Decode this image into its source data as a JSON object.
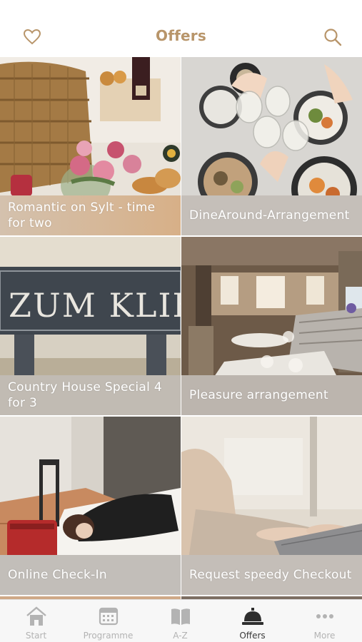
{
  "header": {
    "title": "Offers",
    "accent_color": "#b8956a"
  },
  "offers": [
    {
      "title": "Romantic on Sylt - time for two"
    },
    {
      "title": "DineAround-Arrangement"
    },
    {
      "title": "Country House Special 4 for 3"
    },
    {
      "title": "Pleasure arrangement"
    },
    {
      "title": "Online Check-In"
    },
    {
      "title": "Request speedy Checkout"
    }
  ],
  "tabbar": {
    "items": [
      {
        "label": "Start",
        "icon": "house-icon",
        "active": false
      },
      {
        "label": "Programme",
        "icon": "calendar-icon",
        "active": false
      },
      {
        "label": "A-Z",
        "icon": "book-icon",
        "active": false
      },
      {
        "label": "Offers",
        "icon": "service-bell-icon",
        "active": true
      },
      {
        "label": "More",
        "icon": "more-dots-icon",
        "active": false
      }
    ]
  }
}
